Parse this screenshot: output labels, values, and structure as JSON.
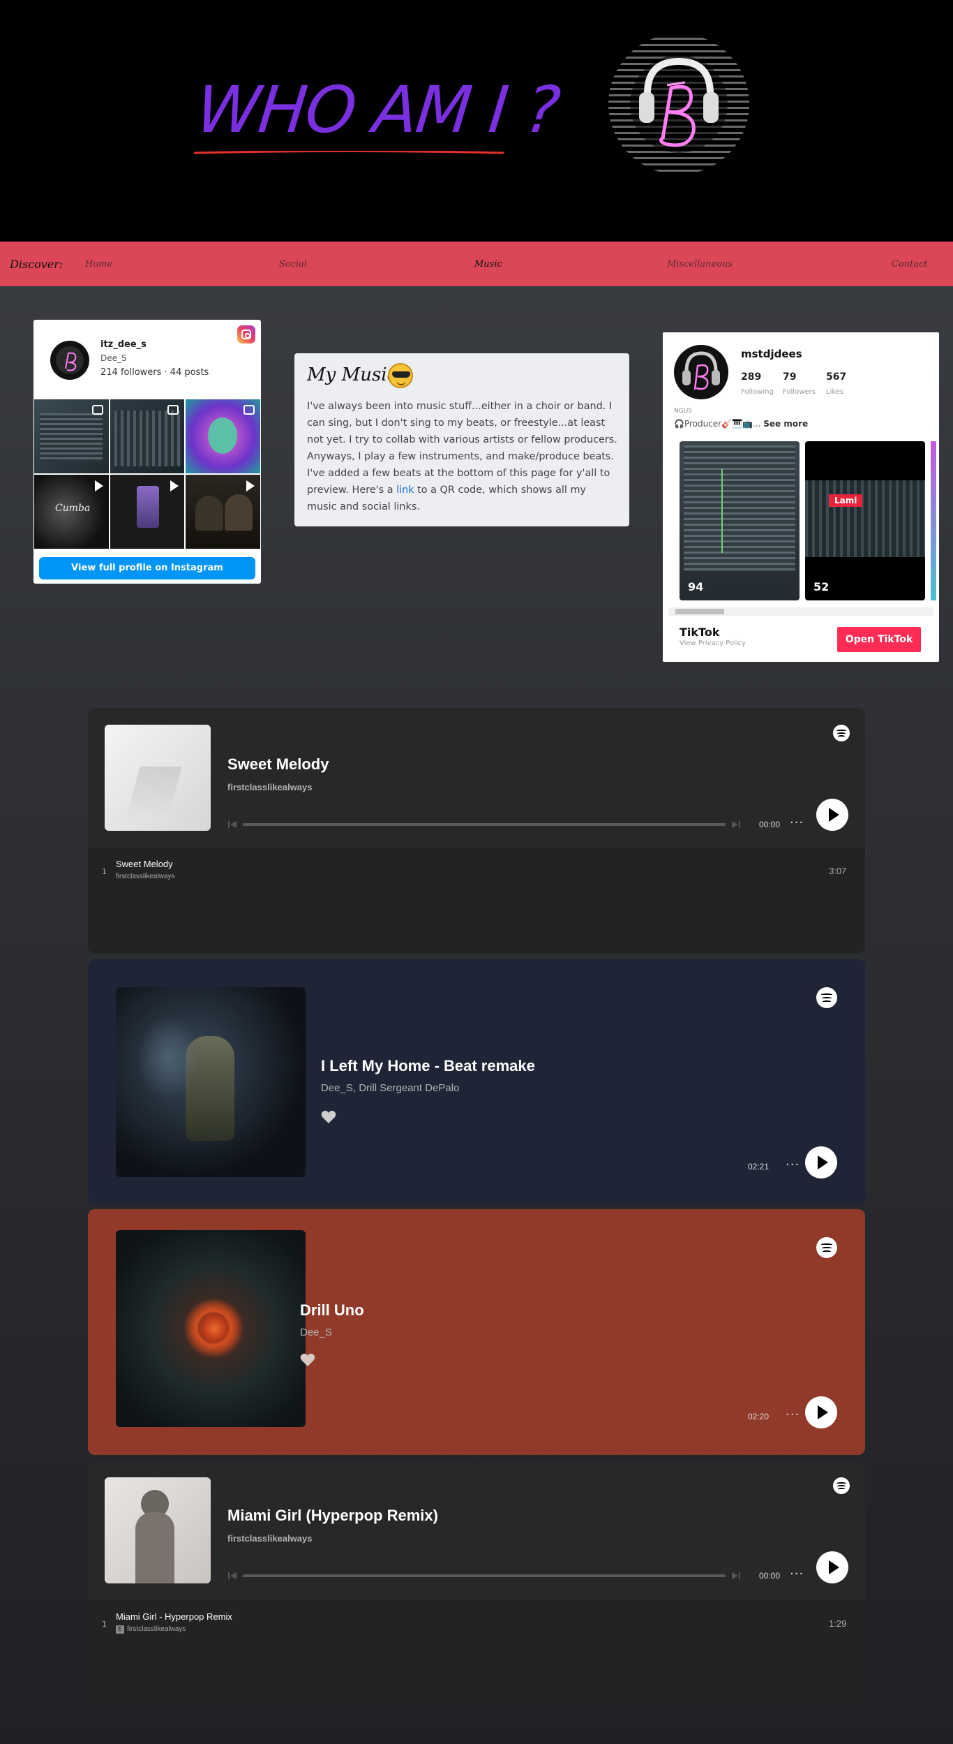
{
  "header": {
    "title": "WHO AM I ?",
    "logo_icon": "db-monogram-logo",
    "accent_color": "#7a2fe0"
  },
  "nav": {
    "label": "Discover:",
    "items": [
      "Home",
      "Social",
      "Music",
      "Miscellaneous",
      "Contact"
    ],
    "active": "Music",
    "background": "#dc4757"
  },
  "instagram": {
    "username": "itz_dee_s",
    "display_name": "Dee_S",
    "stats": "214 followers · 44 posts",
    "button": "View full profile on Instagram",
    "tile_text": "Cumba"
  },
  "my_music": {
    "title": "My Music",
    "body_before_link": "I've always been into music stuff...either in a choir or band. I can sing, but I don't sing to my beats, or freestyle...at least not yet. I try to collab with various artists or fellow producers. Anyways, I play a few instruments, and make/produce beats. I've added a few beats at the bottom of this page for y'all to preview. Here's a ",
    "link_text": "link",
    "body_after_link": " to a QR code, which shows all my music and social links."
  },
  "tiktok": {
    "username": "mstdjdees",
    "following": "289",
    "following_label": "Following",
    "followers": "79",
    "followers_label": "Followers",
    "likes": "567",
    "likes_label": "Likes",
    "ngus": "NGUS",
    "bio": "🎧Producer🎸🎹📺...",
    "see_more": "See more",
    "videos": [
      {
        "views": "94"
      },
      {
        "views": "52",
        "label": "Lami"
      }
    ],
    "brand": "TikTok",
    "policy": "View Privacy Policy",
    "button": "Open TikTok",
    "button_color": "#fe2c55"
  },
  "spotify": [
    {
      "title": "Sweet Melody",
      "artist": "firstclasslikealways",
      "time": "00:00",
      "track": {
        "number": "1",
        "title": "Sweet Melody",
        "artist": "firstclasslikealways",
        "duration": "3:07"
      },
      "background": "#282828"
    },
    {
      "title": "I Left My Home - Beat remake",
      "artist": "Dee_S, Drill Sergeant DePalo",
      "time": "02:21",
      "background": "#1f2536"
    },
    {
      "title": "Drill Uno",
      "artist": "Dee_S",
      "time": "02:20",
      "background": "#923a2a"
    },
    {
      "title": "Miami Girl (Hyperpop Remix)",
      "artist": "firstclasslikealways",
      "time": "00:00",
      "track": {
        "number": "1",
        "title": "Miami Girl - Hyperpop Remix",
        "artist": "firstclasslikealways",
        "duration": "1:29",
        "badge": "E"
      },
      "background": "#282828"
    }
  ]
}
